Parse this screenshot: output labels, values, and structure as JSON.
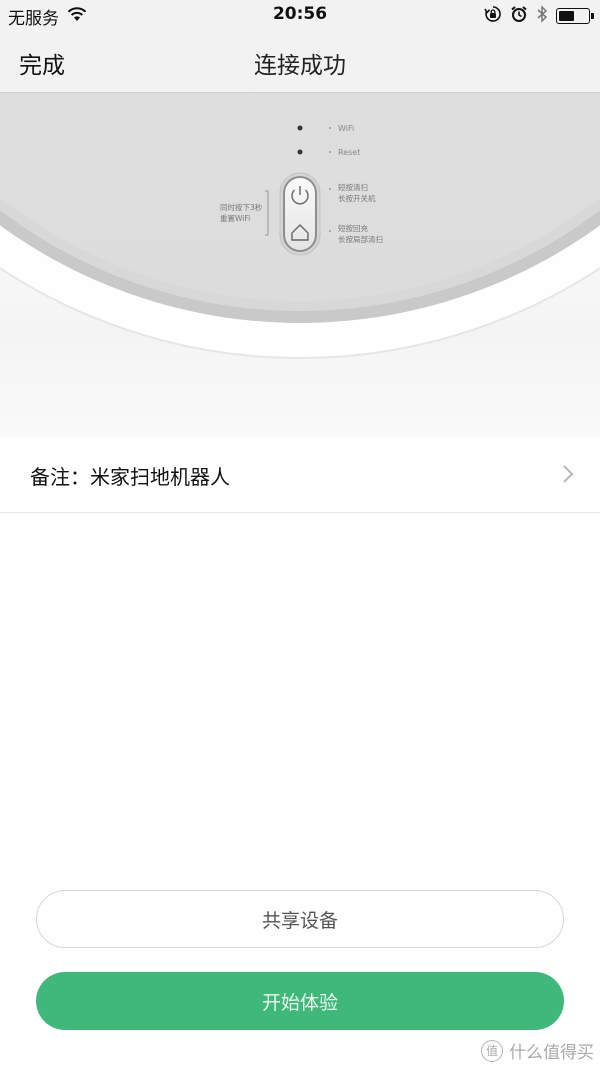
{
  "status_bar": {
    "carrier": "无服务",
    "time": "20:56",
    "battery_level": 0.55
  },
  "nav": {
    "done_label": "完成",
    "title": "连接成功"
  },
  "device_panel": {
    "wifi_label": "WiFi",
    "reset_label": "Reset",
    "left_note_line1": "同时按下3秒",
    "left_note_line2": "重置WiFi",
    "power_note_line1": "短按清扫",
    "power_note_line2": "长按开关机",
    "home_note_line1": "短按回充",
    "home_note_line2": "长按局部清扫"
  },
  "note_row": {
    "label": "备注：米家扫地机器人"
  },
  "buttons": {
    "share_label": "共享设备",
    "start_label": "开始体验"
  },
  "watermark": {
    "text": "什么值得买",
    "badge": "值"
  },
  "colors": {
    "accent_green": "#3fb87a",
    "bar_background": "#f2f2f2"
  },
  "icons": [
    "wifi-icon",
    "rotation-lock-icon",
    "alarm-icon",
    "bluetooth-icon",
    "battery-icon",
    "power-icon",
    "home-icon",
    "chevron-right-icon"
  ]
}
